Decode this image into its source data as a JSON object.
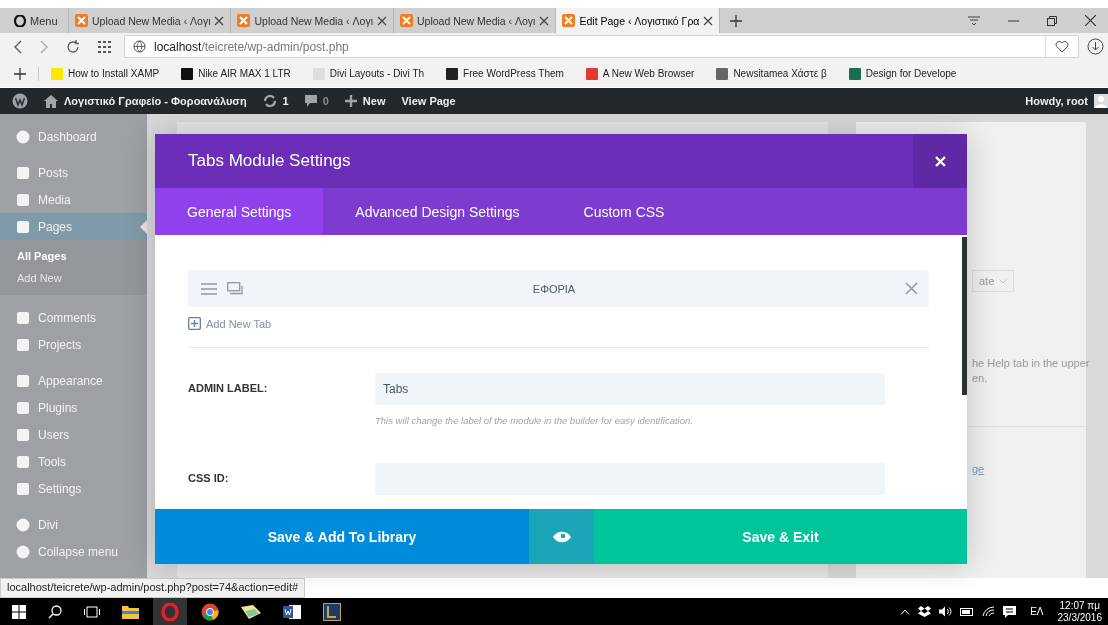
{
  "browser": {
    "tabs": [
      {
        "kind": "menu",
        "title": "Menu",
        "selected": false
      },
      {
        "kind": "page",
        "title": "Upload New Media ‹ Λογι",
        "selected": false
      },
      {
        "kind": "page",
        "title": "Upload New Media ‹ Λογι",
        "selected": false
      },
      {
        "kind": "page",
        "title": "Upload New Media ‹ Λογι",
        "selected": false
      },
      {
        "kind": "page",
        "title": "Edit Page ‹ Λογιστικό Γρα",
        "selected": true
      }
    ],
    "address": {
      "host": "localhost",
      "path": "/teicrete/wp-admin/post.php"
    },
    "bookmarks": [
      "How to Install XAMP",
      "Nike AIR MAX 1 LTR",
      "Divi Layouts - Divi Th",
      "Free WordPress Them",
      "A New Web Browser",
      "Newsitamea Χάστε β",
      "Design for Develope"
    ]
  },
  "admin_bar": {
    "site": "Λογιστικό Γραφείο - Φοροανάλυση",
    "updates": "1",
    "comments": "0",
    "new": "New",
    "view": "View Page",
    "greeting": "Howdy, root"
  },
  "sidebar": {
    "items": [
      {
        "label": "Dashboard",
        "selected": false
      },
      {
        "label": "Posts",
        "selected": false
      },
      {
        "label": "Media",
        "selected": false
      },
      {
        "label": "Pages",
        "selected": true,
        "children": [
          {
            "label": "All Pages",
            "selected": true
          },
          {
            "label": "Add New",
            "selected": false
          }
        ]
      },
      {
        "label": "Comments",
        "selected": false
      },
      {
        "label": "Projects",
        "selected": false
      },
      {
        "label": "Appearance",
        "selected": false
      },
      {
        "label": "Plugins",
        "selected": false
      },
      {
        "label": "Users",
        "selected": false
      },
      {
        "label": "Tools",
        "selected": false
      },
      {
        "label": "Settings",
        "selected": false
      },
      {
        "label": "Divi",
        "selected": false
      },
      {
        "label": "Collapse menu",
        "selected": false
      }
    ]
  },
  "background_panel": {
    "select_text": "ate",
    "help_lines": [
      "he Help tab in the upper",
      "en."
    ],
    "link": "ge"
  },
  "modal": {
    "title": "Tabs Module Settings",
    "tabs": [
      {
        "label": "General Settings",
        "selected": true
      },
      {
        "label": "Advanced Design Settings",
        "selected": false
      },
      {
        "label": "Custom CSS",
        "selected": false
      }
    ],
    "tab_items": [
      {
        "label": "ΕΦΟΡΙΑ"
      }
    ],
    "add_tab": "Add New Tab",
    "fields": [
      {
        "label": "ADMIN LABEL:",
        "value": "Tabs",
        "description": "This will change the label of the module in the builder for easy identification."
      },
      {
        "label": "CSS ID:"
      }
    ],
    "save_library": "Save & Add To Library",
    "save_exit": "Save & Exit"
  },
  "status_url": "localhost/teicrete/wp-admin/post.php?post=74&action=edit#",
  "taskbar": {
    "language": "ΕΛ",
    "time": "12:07 πμ",
    "date": "23/3/2016"
  }
}
